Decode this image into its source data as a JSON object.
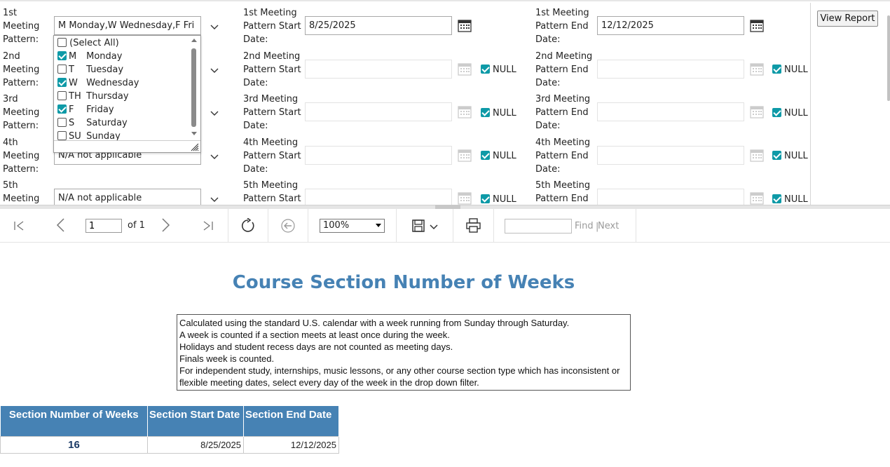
{
  "params": {
    "left_labels": [
      [
        "1st",
        "Meeting",
        "Pattern:"
      ],
      [
        "2nd",
        "Meeting",
        "Pattern:"
      ],
      [
        "3rd",
        "Meeting",
        "Pattern:"
      ],
      [
        "4th",
        "Meeting",
        "Pattern:"
      ],
      [
        "5th",
        "Meeting"
      ]
    ],
    "start_labels": [
      [
        "1st Meeting",
        "Pattern Start",
        "Date:"
      ],
      [
        "2nd Meeting",
        "Pattern Start",
        "Date:"
      ],
      [
        "3rd Meeting",
        "Pattern Start",
        "Date:"
      ],
      [
        "4th Meeting",
        "Pattern Start",
        "Date:"
      ],
      [
        "5th Meeting",
        "Pattern Start"
      ]
    ],
    "end_labels": [
      [
        "1st Meeting",
        "Pattern End",
        "Date:"
      ],
      [
        "2nd Meeting",
        "Pattern End",
        "Date:"
      ],
      [
        "3rd Meeting",
        "Pattern End",
        "Date:"
      ],
      [
        "4th Meeting",
        "Pattern End",
        "Date:"
      ],
      [
        "5th Meeting",
        "Pattern End"
      ]
    ],
    "pattern1_value": "M   Monday,W   Wednesday,F   Fri",
    "pattern4_value": "N/A  not applicable",
    "pattern5_value": "N/A  not applicable",
    "start1_value": "8/25/2025",
    "end1_value": "12/12/2025",
    "null_label": "NULL",
    "view_report": "View Report"
  },
  "dropdown": {
    "items": [
      {
        "code": "",
        "label": "(Select All)",
        "checked": false
      },
      {
        "code": "M",
        "label": "Monday",
        "checked": true
      },
      {
        "code": "T",
        "label": "Tuesday",
        "checked": false
      },
      {
        "code": "W",
        "label": "Wednesday",
        "checked": true
      },
      {
        "code": "TH",
        "label": "Thursday",
        "checked": false
      },
      {
        "code": "F",
        "label": "Friday",
        "checked": true
      },
      {
        "code": "S",
        "label": "Saturday",
        "checked": false
      },
      {
        "code": "SU",
        "label": "Sunday",
        "checked": false
      }
    ]
  },
  "toolbar": {
    "page_value": "1",
    "of_text": "of 1",
    "zoom": "100%",
    "find_label": "Find",
    "next_label": "Next",
    "separator": "|"
  },
  "report": {
    "title": "Course Section Number of Weeks",
    "notes": [
      "Calculated using the standard U.S. calendar with a week running from Sunday through Saturday.",
      "A week is counted if a section meets at least once during the week.",
      "Holidays and student recess days are not counted as meeting days.",
      "Finals week is counted.",
      "For independent study, internships, music lessons, or any other course section type which has inconsistent or",
      "flexible meeting dates, select every day of the week in the drop down filter."
    ],
    "table": {
      "headers": [
        "Section Number of Weeks",
        "Section Start Date",
        "Section End Date"
      ],
      "rows": [
        [
          "16",
          "8/25/2025",
          "12/12/2025"
        ]
      ]
    }
  },
  "colors": {
    "accent": "#4682b4",
    "checkbox": "#0e9aa7"
  }
}
